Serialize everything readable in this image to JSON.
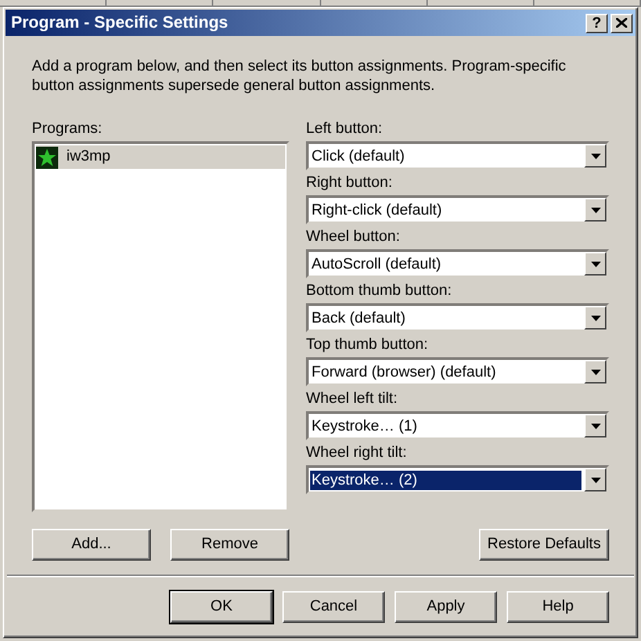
{
  "window": {
    "title": "Program - Specific Settings",
    "help_button": "?"
  },
  "intro": "Add a program below, and then select its button assignments. Program-specific button assignments supersede general button assignments.",
  "programs": {
    "label": "Programs:",
    "items": [
      {
        "name": "iw3mp",
        "selected": true
      }
    ]
  },
  "assignments": [
    {
      "label": "Left button:",
      "value": "Click (default)",
      "focused": false
    },
    {
      "label": "Right button:",
      "value": "Right-click (default)",
      "focused": false
    },
    {
      "label": "Wheel button:",
      "value": "AutoScroll (default)",
      "focused": false
    },
    {
      "label": "Bottom thumb button:",
      "value": "Back (default)",
      "focused": false
    },
    {
      "label": "Top thumb button:",
      "value": "Forward (browser) (default)",
      "focused": false
    },
    {
      "label": "Wheel left tilt:",
      "value": "Keystroke… (1)",
      "focused": false
    },
    {
      "label": "Wheel right tilt:",
      "value": "Keystroke… (2)",
      "focused": true
    }
  ],
  "program_buttons": [
    "Add...",
    "Remove"
  ],
  "restore_button": "Restore Defaults",
  "dialog_buttons": [
    {
      "label": "OK",
      "default": true
    },
    {
      "label": "Cancel",
      "default": false
    },
    {
      "label": "Apply",
      "default": false
    },
    {
      "label": "Help",
      "default": false
    }
  ]
}
